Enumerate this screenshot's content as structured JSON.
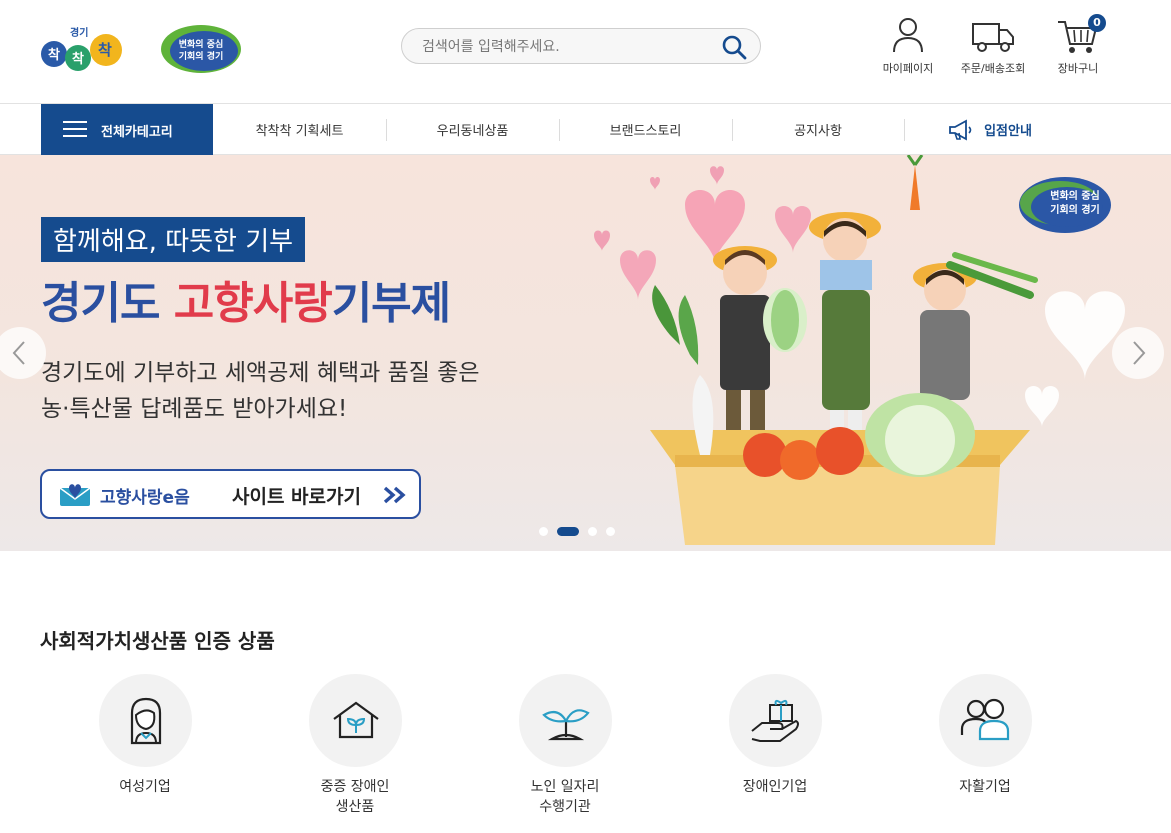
{
  "header": {
    "logo_small_text": "경기",
    "logo_text": "착착착",
    "badge_line1": "변화의 중심",
    "badge_line2": "기회의 경기",
    "search_placeholder": "검색어를 입력해주세요.",
    "utilities": [
      {
        "label": "마이페이지",
        "icon": "person-icon"
      },
      {
        "label": "주문/배송조회",
        "icon": "truck-icon"
      },
      {
        "label": "장바구니",
        "icon": "cart-icon"
      }
    ],
    "cart_count": "0"
  },
  "nav": {
    "all_category": "전체카테고리",
    "items": [
      "착착착 기획세트",
      "우리동네상품",
      "브랜드스토리",
      "공지사항"
    ],
    "entry_label": "입점안내"
  },
  "banner": {
    "tag": "함께해요, 따뜻한 기부",
    "head_part1": "경기도 ",
    "head_highlight": "고향사랑",
    "head_part2": "기부제",
    "desc_line1": "경기도에 기부하고 세액공제 혜택과 품질 좋은",
    "desc_line2": "농·특산물 답례품도 받아가세요!",
    "button_brand": "고향사랑e음",
    "button_label": "사이트 바로가기",
    "badge_line1": "변화의 중심",
    "badge_line2": "기회의 경기",
    "slides_total": 4,
    "slide_active": 2
  },
  "section": {
    "title": "사회적가치생산품 인증 상품",
    "categories": [
      {
        "label": "여성기업",
        "icon": "woman-icon"
      },
      {
        "label": "중증 장애인\n생산품",
        "icon": "greenhouse-icon"
      },
      {
        "label": "노인 일자리\n수행기관",
        "icon": "sprout-icon"
      },
      {
        "label": "장애인기업",
        "icon": "gift-hand-icon"
      },
      {
        "label": "자활기업",
        "icon": "people-icon"
      }
    ]
  },
  "colors": {
    "primary": "#154b8e",
    "headline_blue": "#2a4fa0",
    "headline_red": "#e13b4b"
  }
}
